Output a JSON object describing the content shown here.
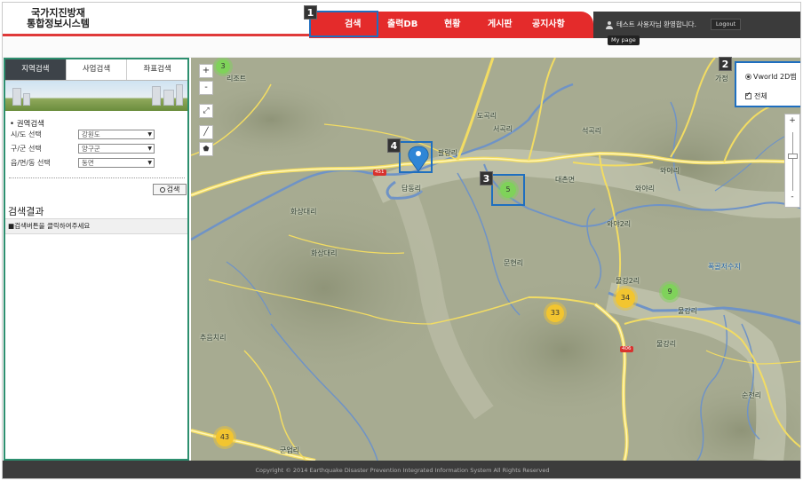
{
  "header": {
    "logo_line1": "국가지진방재",
    "logo_line2": "통합정보시스템",
    "nav": [
      "검색",
      "출력DB",
      "현황",
      "게시판",
      "공지사항"
    ],
    "user_text": "테스트 사용자님 환영합니다.",
    "logout": "Logout",
    "mypage_tooltip": "My page"
  },
  "panel": {
    "tabs": [
      "지역검색",
      "사업검색",
      "좌표검색"
    ],
    "section_title": "• 권역검색",
    "filters": [
      {
        "label": "시/도 선택",
        "value": "강원도"
      },
      {
        "label": "구/군 선택",
        "value": "양구군"
      },
      {
        "label": "읍/면/동 선택",
        "value": "동면"
      }
    ],
    "search_button": "검색",
    "result_title": "검색결과",
    "result_hint": "■검색버튼을 클릭하여주세요"
  },
  "map": {
    "layers": {
      "base_option": "Vworld 2D맵",
      "all_option": "전체"
    },
    "zoom_in": "+",
    "zoom_out": "-",
    "places": [
      "리조트",
      "가정",
      "도곡리",
      "서곡리",
      "석곡리",
      "팔랑리",
      "대촌면",
      "와야리",
      "와야리",
      "와야2리",
      "답동리",
      "화상대리",
      "화상대리",
      "문현리",
      "물강2리",
      "물강리",
      "물강리",
      "폭골저수지",
      "추음치리",
      "순천리",
      "군업리"
    ],
    "road_badges": [
      "451",
      "406"
    ],
    "clusters": [
      {
        "count": "3",
        "color": "green"
      },
      {
        "count": "5",
        "color": "green"
      },
      {
        "count": "34",
        "color": "yellow"
      },
      {
        "count": "9",
        "color": "green"
      },
      {
        "count": "33",
        "color": "yellow"
      },
      {
        "count": "43",
        "color": "yellow"
      }
    ]
  },
  "callouts": [
    "1",
    "2",
    "3",
    "4"
  ],
  "footer": "Copyright © 2014 Earthquake Disaster Prevention Integrated Information System All Rights Reserved"
}
